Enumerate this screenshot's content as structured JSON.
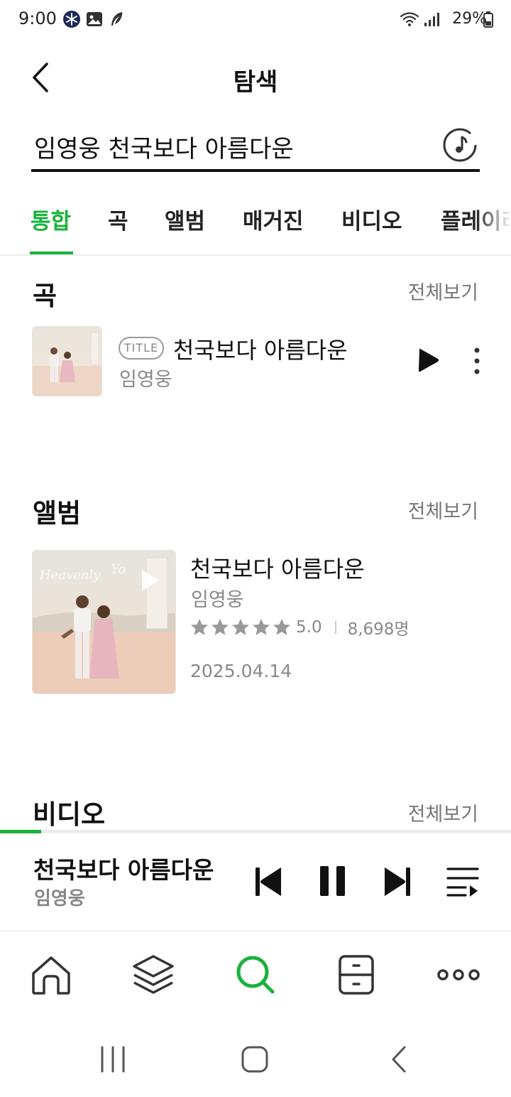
{
  "status_bar": {
    "time": "9:00",
    "battery_text": "29%",
    "left_icons": [
      "snowflake-app-icon",
      "gallery-icon",
      "feather-app-icon"
    ],
    "right_icons": [
      "wifi-icon",
      "signal-icon",
      "battery-icon"
    ]
  },
  "header": {
    "title": "탐색",
    "back_icon": "chevron-left-icon"
  },
  "search": {
    "query": "임영웅 천국보다 아름다운",
    "music_recognition_icon": "music-note-icon"
  },
  "tabs": {
    "items": [
      {
        "label": "통합",
        "active": true
      },
      {
        "label": "곡",
        "active": false
      },
      {
        "label": "앨범",
        "active": false
      },
      {
        "label": "매거진",
        "active": false
      },
      {
        "label": "비디오",
        "active": false
      },
      {
        "label": "플레이리",
        "active": false
      }
    ]
  },
  "colors": {
    "accent": "#19b23b",
    "text": "#111111",
    "secondary_text": "#888888"
  },
  "songs_section": {
    "title": "곡",
    "see_all": "전체보기",
    "items": [
      {
        "badge": "TITLE",
        "title": "천국보다 아름다운",
        "artist": "임영웅"
      }
    ]
  },
  "albums_section": {
    "title": "앨범",
    "see_all": "전체보기",
    "items": [
      {
        "title": "천국보다 아름다운",
        "artist": "임영웅",
        "rating": "5.0",
        "rating_stars": 5,
        "rating_count": "8,698명",
        "release_date": "2025.04.14"
      }
    ]
  },
  "videos_section": {
    "title": "비디오",
    "see_all": "전체보기"
  },
  "now_playing": {
    "title": "천국보다 아름다운",
    "artist": "임영웅",
    "progress": 0.08,
    "controls": [
      "skip-previous-icon",
      "pause-icon",
      "skip-next-icon",
      "playlist-icon"
    ]
  },
  "bottom_nav": {
    "items": [
      {
        "icon": "home-icon",
        "active": false
      },
      {
        "icon": "layers-icon",
        "active": false
      },
      {
        "icon": "search-icon",
        "active": true
      },
      {
        "icon": "drawer-icon",
        "active": false
      },
      {
        "icon": "more-icon",
        "active": false
      }
    ]
  },
  "system_nav": {
    "items": [
      "recent-apps-icon",
      "home-button-icon",
      "back-icon"
    ]
  }
}
